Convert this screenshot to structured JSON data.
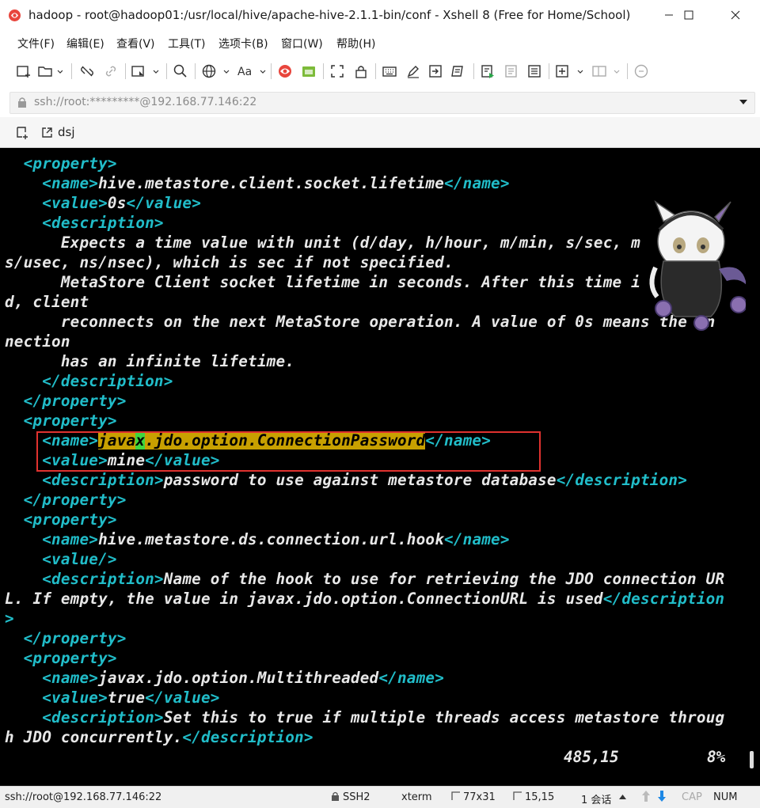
{
  "window": {
    "title": "hadoop - root@hadoop01:/usr/local/hive/apache-hive-2.1.1-bin/conf - Xshell 8 (Free for Home/School)"
  },
  "menu": [
    "文件(F)",
    "编辑(E)",
    "查看(V)",
    "工具(T)",
    "选项卡(B)",
    "窗口(W)",
    "帮助(H)"
  ],
  "address": {
    "value": "ssh://root:*********@192.168.77.146:22"
  },
  "tab": {
    "label": "dsj"
  },
  "terminal": {
    "lines": [
      [
        {
          "t": "  "
        },
        {
          "t": "<property>",
          "c": "tag"
        }
      ],
      [
        {
          "t": "    "
        },
        {
          "t": "<name>",
          "c": "tag"
        },
        {
          "t": "hive.metastore.client.socket.lifetime"
        },
        {
          "t": "</name>",
          "c": "tag"
        }
      ],
      [
        {
          "t": "    "
        },
        {
          "t": "<value>",
          "c": "tag"
        },
        {
          "t": "0s"
        },
        {
          "t": "</value>",
          "c": "tag"
        }
      ],
      [
        {
          "t": "    "
        },
        {
          "t": "<description>",
          "c": "tag"
        }
      ],
      [
        {
          "t": "      Expects a time value with unit (d/day, h/hour, m/min, s/sec, m    u"
        }
      ],
      [
        {
          "t": "s/usec, ns/nsec), which is sec if not specified."
        }
      ],
      [
        {
          "t": "      MetaStore Client socket lifetime in seconds. After this time i    e"
        }
      ],
      [
        {
          "t": "d, client"
        }
      ],
      [
        {
          "t": "      reconnects on the next MetaStore operation. A value of 0s means the on"
        }
      ],
      [
        {
          "t": "nection"
        }
      ],
      [
        {
          "t": "      has an infinite lifetime."
        }
      ],
      [
        {
          "t": "    "
        },
        {
          "t": "</description>",
          "c": "tag"
        }
      ],
      [
        {
          "t": "  "
        },
        {
          "t": "</property>",
          "c": "tag"
        }
      ],
      [
        {
          "t": "  "
        },
        {
          "t": "<property>",
          "c": "tag"
        }
      ],
      [
        {
          "t": "    "
        },
        {
          "t": "<name>",
          "c": "tag"
        },
        {
          "t": "java",
          "c": "hl"
        },
        {
          "t": "x",
          "c": "cursor"
        },
        {
          "t": ".jdo.option.ConnectionPassword",
          "c": "hl"
        },
        {
          "t": "</name>",
          "c": "tag"
        }
      ],
      [
        {
          "t": "    "
        },
        {
          "t": "<value>",
          "c": "tag"
        },
        {
          "t": "mine"
        },
        {
          "t": "</value>",
          "c": "tag"
        }
      ],
      [
        {
          "t": "    "
        },
        {
          "t": "<description>",
          "c": "tag"
        },
        {
          "t": "password to use against metastore database"
        },
        {
          "t": "</description>",
          "c": "tag"
        }
      ],
      [
        {
          "t": "  "
        },
        {
          "t": "</property>",
          "c": "tag"
        }
      ],
      [
        {
          "t": "  "
        },
        {
          "t": "<property>",
          "c": "tag"
        }
      ],
      [
        {
          "t": "    "
        },
        {
          "t": "<name>",
          "c": "tag"
        },
        {
          "t": "hive.metastore.ds.connection.url.hook"
        },
        {
          "t": "</name>",
          "c": "tag"
        }
      ],
      [
        {
          "t": "    "
        },
        {
          "t": "<value/>",
          "c": "tag"
        }
      ],
      [
        {
          "t": "    "
        },
        {
          "t": "<description>",
          "c": "tag"
        },
        {
          "t": "Name of the hook to use for retrieving the JDO connection UR"
        }
      ],
      [
        {
          "t": "L. If empty, the value in javax.jdo.option.ConnectionURL is used"
        },
        {
          "t": "</description",
          "c": "tag"
        }
      ],
      [
        {
          "t": ">",
          "c": "tag"
        }
      ],
      [
        {
          "t": "  "
        },
        {
          "t": "</property>",
          "c": "tag"
        }
      ],
      [
        {
          "t": "  "
        },
        {
          "t": "<property>",
          "c": "tag"
        }
      ],
      [
        {
          "t": "    "
        },
        {
          "t": "<name>",
          "c": "tag"
        },
        {
          "t": "javax.jdo.option.Multithreaded"
        },
        {
          "t": "</name>",
          "c": "tag"
        }
      ],
      [
        {
          "t": "    "
        },
        {
          "t": "<value>",
          "c": "tag"
        },
        {
          "t": "true"
        },
        {
          "t": "</value>",
          "c": "tag"
        }
      ],
      [
        {
          "t": "    "
        },
        {
          "t": "<description>",
          "c": "tag"
        },
        {
          "t": "Set this to true if multiple threads access metastore throug"
        }
      ],
      [
        {
          "t": "h JDO concurrently."
        },
        {
          "t": "</description>",
          "c": "tag"
        }
      ]
    ],
    "position": "485,15",
    "percent": "8%"
  },
  "statusbar": {
    "connection": "ssh://root@192.168.77.146:22",
    "protocol": "SSH2",
    "terminal_type": "xterm",
    "size": "77x31",
    "cursor": "15,15",
    "sessions": "1 会话",
    "cap": "CAP",
    "num": "NUM"
  },
  "colors": {
    "tag": "#21bdc9",
    "highlight": "#c8a000",
    "cursor": "#3fd63f",
    "annotation_box": "#e0322f"
  }
}
